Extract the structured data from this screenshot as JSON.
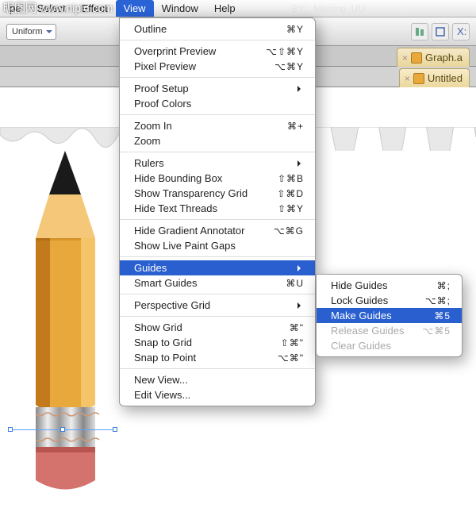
{
  "menubar": {
    "items": [
      "pe",
      "Select",
      "Effect",
      "View",
      "Window",
      "Help"
    ],
    "active_index": 3
  },
  "watermark1": "昵图网 www.nipic.com",
  "watermark2": "BY：Missing_UU",
  "toolbar": {
    "uniform_label": "Uniform"
  },
  "doctabs": {
    "tab1": "Graph.a",
    "tab2": "Untitled"
  },
  "view_menu": {
    "groups": [
      [
        {
          "label": "Outline",
          "shortcut": "⌘Y"
        }
      ],
      [
        {
          "label": "Overprint Preview",
          "shortcut": "⌥⇧⌘Y"
        },
        {
          "label": "Pixel Preview",
          "shortcut": "⌥⌘Y"
        }
      ],
      [
        {
          "label": "Proof Setup",
          "submenu": true
        },
        {
          "label": "Proof Colors"
        }
      ],
      [
        {
          "label": "Zoom In",
          "shortcut": "⌘+"
        },
        {
          "label": "Zoom",
          "truncated": true
        }
      ],
      [
        {
          "label": "Rulers",
          "submenu": true
        },
        {
          "label": "Hide Bounding Box",
          "shortcut": "⇧⌘B"
        },
        {
          "label": "Show Transparency Grid",
          "shortcut": "⇧⌘D"
        },
        {
          "label": "Hide Text Threads",
          "shortcut": "⇧⌘Y"
        }
      ],
      [
        {
          "label": "Hide Gradient Annotator",
          "shortcut": "⌥⌘G"
        },
        {
          "label": "Show Live Paint Gaps"
        }
      ],
      [
        {
          "label": "Guides",
          "submenu": true,
          "selected": true
        },
        {
          "label": "Smart Guides",
          "shortcut": "⌘U"
        }
      ],
      [
        {
          "label": "Perspective Grid",
          "submenu": true
        }
      ],
      [
        {
          "label": "Show Grid",
          "shortcut": "⌘\""
        },
        {
          "label": "Snap to Grid",
          "shortcut": "⇧⌘\""
        },
        {
          "label": "Snap to Point",
          "shortcut": "⌥⌘\""
        }
      ],
      [
        {
          "label": "New View..."
        },
        {
          "label": "Edit Views..."
        }
      ]
    ]
  },
  "guides_submenu": {
    "items": [
      {
        "label": "Hide Guides",
        "shortcut": "⌘;"
      },
      {
        "label": "Lock Guides",
        "shortcut": "⌥⌘;"
      },
      {
        "label": "Make Guides",
        "shortcut": "⌘5",
        "selected": true
      },
      {
        "label": "Release Guides",
        "shortcut": "⌥⌘5",
        "disabled": true
      },
      {
        "label": "Clear Guides",
        "disabled": true
      }
    ]
  }
}
